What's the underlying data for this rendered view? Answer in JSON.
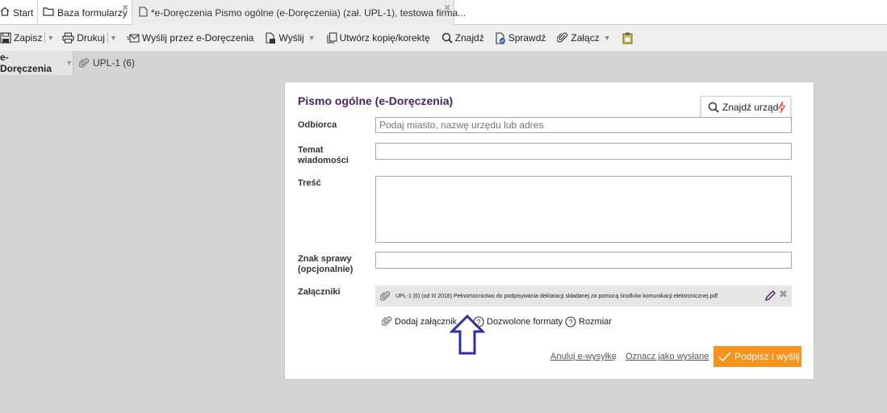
{
  "tabs": {
    "start": "Start",
    "baza": "Baza formularzy",
    "active": "*e-Doręczenia Pismo ogólne (e-Doręczenia) (zał. UPL-1), testowa firma..."
  },
  "toolbar": {
    "zapisz": "Zapisz",
    "drukuj": "Drukuj",
    "wyslij_edor": "Wyślij przez e-Doręczenia",
    "wyslij": "Wyślij",
    "utworz": "Utwórz kopię/korektę",
    "znajdz": "Znajdź",
    "sprawdz": "Sprawdź",
    "zalacz": "Załącz"
  },
  "subtabs": {
    "active": "e-Doręczenia",
    "second": "UPL-1 (6)"
  },
  "form": {
    "title": "Pismo ogólne (e-Doręczenia)",
    "find_office": "Znajdź urząd",
    "recipient_label": "Odbiorca",
    "recipient_placeholder": "Podaj miasto, nazwę urzędu lub adres",
    "subject_label_1": "Temat",
    "subject_label_2": "wiadomości",
    "subject_value": "",
    "content_label": "Treść",
    "content_value": "",
    "case_label_1": "Znak sprawy",
    "case_label_2": "(opcjonalnie)",
    "case_value": "",
    "attachments_label": "Załączniki",
    "attachment_name": "UPL-1 (6) (od III 2018) Pełnomocnictwo do podpisywania deklaracji składanej za pomocą środków komunikacji elektronicznej.pdf",
    "add_attachment": "Dodaj załącznik",
    "allowed_formats": "Dozwolone formaty",
    "size": "Rozmiar",
    "cancel": "Anuluj e-wysyłkę",
    "mark_sent": "Oznacz jako wysłane",
    "sign_send": "Podpisz i wyślij"
  },
  "colors": {
    "accent_purple": "#4a2364",
    "sign_orange": "#f7941d",
    "annotation_blue": "#2e2fa8"
  }
}
